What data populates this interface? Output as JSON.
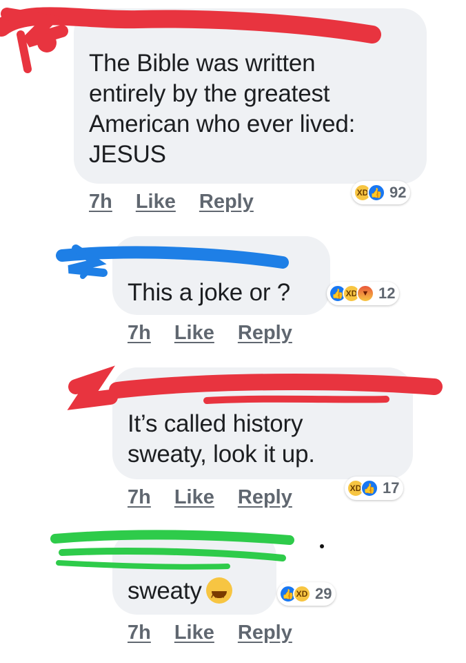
{
  "comments": [
    {
      "text_lines": [
        "The Bible was written",
        "entirely by the greatest",
        "American who ever lived:",
        "JESUS"
      ],
      "time": "7h",
      "like_label": "Like",
      "reply_label": "Reply",
      "reactions": [
        "haha",
        "like"
      ],
      "reaction_count": "92"
    },
    {
      "text_lines": [
        "This a joke or ?"
      ],
      "time": "7h",
      "like_label": "Like",
      "reply_label": "Reply",
      "reactions": [
        "like",
        "haha",
        "angry"
      ],
      "reaction_count": "12"
    },
    {
      "text_lines": [
        "It’s called history",
        "sweaty, look it up."
      ],
      "time": "7h",
      "like_label": "Like",
      "reply_label": "Reply",
      "reactions": [
        "haha",
        "like"
      ],
      "reaction_count": "17"
    },
    {
      "text_lines": [
        "sweaty"
      ],
      "inline_emoji": "tears-of-joy",
      "time": "7h",
      "like_label": "Like",
      "reply_label": "Reply",
      "reactions": [
        "like",
        "haha"
      ],
      "reaction_count": "29"
    }
  ],
  "colors": {
    "bubble": "#eff1f4",
    "redact_red": "#e8343f",
    "redact_blue": "#1e7fe6",
    "redact_green": "#2ecb4a"
  }
}
